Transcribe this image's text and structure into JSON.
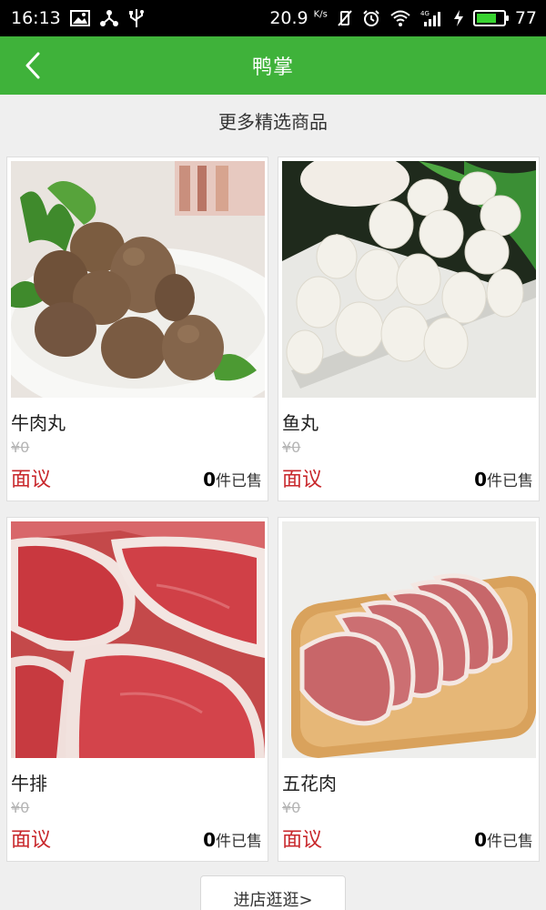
{
  "status_bar": {
    "time": "16:13",
    "speed": "20.9",
    "speed_unit": "K/s",
    "network": "4G",
    "battery": "77",
    "battery_level": 0.77
  },
  "app_bar": {
    "title": "鸭掌",
    "back_icon": "chevron-left-icon"
  },
  "section": {
    "title": "更多精选商品"
  },
  "products": [
    {
      "name": "牛肉丸",
      "old_price": "¥0",
      "price": "面议",
      "sold_count": "0",
      "sold_suffix": "件已售",
      "image": "beef-meatballs"
    },
    {
      "name": "鱼丸",
      "old_price": "¥0",
      "price": "面议",
      "sold_count": "0",
      "sold_suffix": "件已售",
      "image": "fish-balls"
    },
    {
      "name": "牛排",
      "old_price": "¥0",
      "price": "面议",
      "sold_count": "0",
      "sold_suffix": "件已售",
      "image": "steak"
    },
    {
      "name": "五花肉",
      "old_price": "¥0",
      "price": "面议",
      "sold_count": "0",
      "sold_suffix": "件已售",
      "image": "pork-belly"
    }
  ],
  "footer": {
    "store_button": "进店逛逛>"
  },
  "colors": {
    "accent": "#3fb23a",
    "price": "#c8272b",
    "background": "#efefef"
  }
}
